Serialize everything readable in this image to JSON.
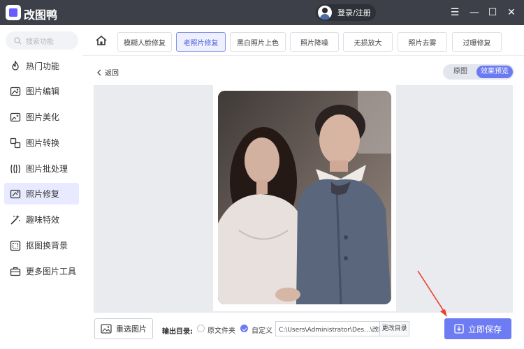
{
  "app": {
    "title": "改图鸭",
    "login_label": "登录/注册"
  },
  "window_controls": {
    "menu": "☰",
    "minimize": "—",
    "maximize": "☐",
    "close": "✕"
  },
  "sidebar": {
    "search_placeholder": "搜索功能",
    "items": [
      {
        "label": "热门功能",
        "icon": "flame-icon"
      },
      {
        "label": "图片编辑",
        "icon": "image-edit-icon"
      },
      {
        "label": "图片美化",
        "icon": "image-beautify-icon"
      },
      {
        "label": "图片转换",
        "icon": "image-convert-icon"
      },
      {
        "label": "图片批处理",
        "icon": "batch-icon"
      },
      {
        "label": "照片修复",
        "icon": "photo-repair-icon",
        "active": true
      },
      {
        "label": "趣味特效",
        "icon": "magic-wand-icon"
      },
      {
        "label": "抠图换背景",
        "icon": "cutout-icon"
      },
      {
        "label": "更多图片工具",
        "icon": "toolbox-icon"
      }
    ]
  },
  "tabs": [
    {
      "label": "模糊人脸修复"
    },
    {
      "label": "老照片修复",
      "active": true
    },
    {
      "label": "黑白照片上色"
    },
    {
      "label": "照片降噪"
    },
    {
      "label": "无损放大"
    },
    {
      "label": "照片去雾"
    },
    {
      "label": "过曝修复"
    }
  ],
  "main": {
    "back_label": "返回",
    "view_original": "原图",
    "view_effect": "效果预览"
  },
  "bottom": {
    "reselect_label": "重选图片",
    "output_label": "输出目录:",
    "option_source": "原文件夹",
    "option_custom": "自定义",
    "path_value": "C:\\Users\\Administrator\\Des...\\改图鸭",
    "change_dir_label": "更改目录",
    "save_label": "立即保存"
  },
  "colors": {
    "accent": "#6d7cf2",
    "titlebar": "#3d4049",
    "annotation_arrow": "#e8412c"
  }
}
